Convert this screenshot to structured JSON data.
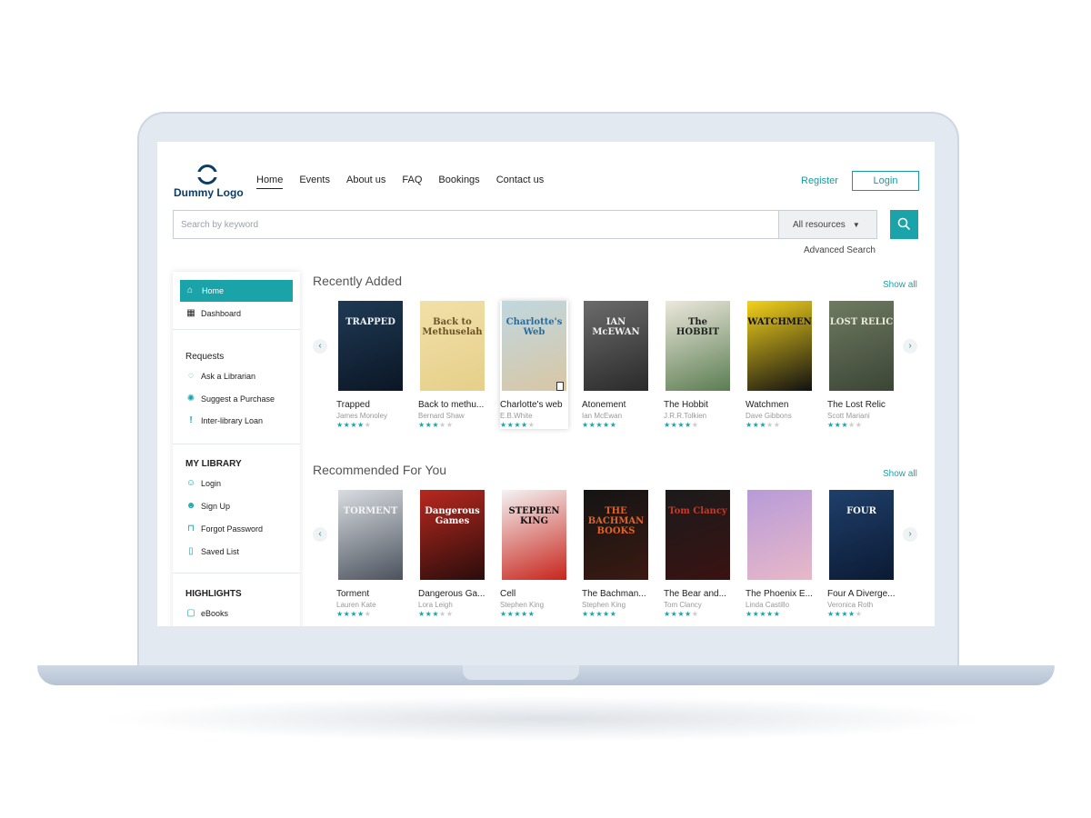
{
  "header": {
    "logo_text": "Dummy Logo",
    "nav": [
      {
        "label": "Home",
        "active": true
      },
      {
        "label": "Events"
      },
      {
        "label": "About us"
      },
      {
        "label": "FAQ"
      },
      {
        "label": "Bookings"
      },
      {
        "label": "Contact us"
      }
    ],
    "register_label": "Register",
    "login_label": "Login"
  },
  "search": {
    "placeholder": "Search by keyword",
    "resources_value": "All resources",
    "advanced_label": "Advanced Search"
  },
  "sidebar": {
    "home": "Home",
    "dashboard": "Dashboard",
    "requests_heading": "Requests",
    "requests": [
      "Ask a Librarian",
      "Suggest a Purchase",
      "Inter-library Loan"
    ],
    "my_library_heading": "MY LIBRARY",
    "my_library": [
      "Login",
      "Sign Up",
      "Forgot Password",
      "Saved List"
    ],
    "highlights_heading": "HIGHLIGHTS",
    "highlights": [
      "eBooks"
    ]
  },
  "recent": {
    "title": "Recently Added",
    "show_all": "Show all",
    "books": [
      {
        "title": "Trapped",
        "author": "James Monoley",
        "rating": 4,
        "cover": "TRAPPED",
        "colors": [
          "#1f3a55",
          "#0b1624"
        ],
        "text_color": "#e8eef3"
      },
      {
        "title": "Back to methu...",
        "author": "Bernard Shaw",
        "rating": 3,
        "cover": "Back to Methuselah",
        "colors": [
          "#f1e0a8",
          "#e6cf8a"
        ],
        "text_color": "#6a5328"
      },
      {
        "title": "Charlotte's web",
        "author": "E.B.White",
        "rating": 4,
        "cover": "Charlotte's Web",
        "colors": [
          "#bfd8e0",
          "#d9c6a4"
        ],
        "text_color": "#2a6b9a"
      },
      {
        "title": "Atonement",
        "author": "Ian McEwan",
        "rating": 5,
        "cover": "IAN McEWAN",
        "colors": [
          "#6b6b6b",
          "#2a2a2a"
        ],
        "text_color": "#eeeeee"
      },
      {
        "title": "The Hobbit",
        "author": "J.R.R.Tolkien",
        "rating": 4,
        "cover": "The HOBBIT",
        "colors": [
          "#ece8dc",
          "#5b7d52"
        ],
        "text_color": "#222222"
      },
      {
        "title": "Watchmen",
        "author": "Dave Gibbons",
        "rating": 3,
        "cover": "WATCHMEN",
        "colors": [
          "#f3d21c",
          "#111111"
        ],
        "text_color": "#111111"
      },
      {
        "title": "The Lost Relic",
        "author": "Scott Mariani",
        "rating": 3,
        "cover": "LOST RELIC",
        "colors": [
          "#6f7a62",
          "#3b4535"
        ],
        "text_color": "#e8ead8"
      }
    ]
  },
  "recommended": {
    "title": "Recommended For You",
    "show_all": "Show all",
    "books": [
      {
        "title": "Torment",
        "author": "Lauren Kate",
        "rating": 4,
        "cover": "TORMENT",
        "colors": [
          "#d9dde2",
          "#4b525c"
        ],
        "text_color": "#f3f3f3"
      },
      {
        "title": "Dangerous Ga...",
        "author": "Lora Leigh",
        "rating": 3,
        "cover": "Dangerous Games",
        "colors": [
          "#b8281f",
          "#2a0d0b"
        ],
        "text_color": "#ffffff"
      },
      {
        "title": "Cell",
        "author": "Stephen King",
        "rating": 5,
        "cover": "STEPHEN KING",
        "colors": [
          "#f4f4f4",
          "#c8251c"
        ],
        "text_color": "#111111"
      },
      {
        "title": "The Bachman...",
        "author": "Stephen King",
        "rating": 5,
        "cover": "THE BACHMAN BOOKS",
        "colors": [
          "#141414",
          "#3a1a12"
        ],
        "text_color": "#e0632a"
      },
      {
        "title": "The Bear and...",
        "author": "Tom Clancy",
        "rating": 4,
        "cover": "Tom Clancy",
        "colors": [
          "#1b1b1b",
          "#3a1212"
        ],
        "text_color": "#c53a2b"
      },
      {
        "title": "The Phoenix E...",
        "author": "Linda Castillo",
        "rating": 5,
        "cover": "",
        "colors": [
          "#b79bd8",
          "#e8b8c8"
        ],
        "text_color": "#ffffff"
      },
      {
        "title": "Four A Diverge...",
        "author": "Veronica Roth",
        "rating": 4,
        "cover": "FOUR",
        "colors": [
          "#1f3f6a",
          "#0b1a33"
        ],
        "text_color": "#f5f5f5"
      }
    ]
  }
}
